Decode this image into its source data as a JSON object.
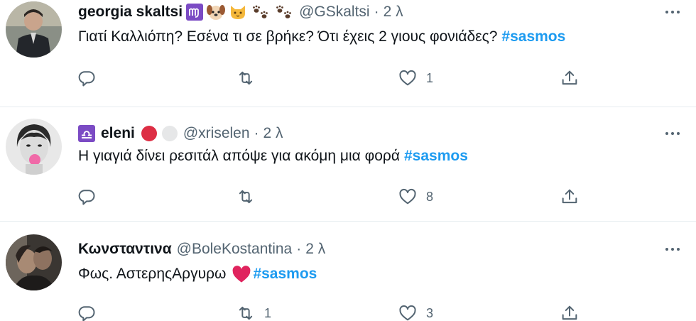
{
  "tweets": [
    {
      "name": "georgia skaltsi",
      "handle": "@GSkaltsi",
      "dot": "·",
      "time": "2 λ",
      "text": "Γιατί Καλλιόπη? Εσένα τι σε βρήκε? Ότι έχεις 2 γιους φονιάδες?",
      "hashtag": "#sasmos",
      "reply_count": "",
      "retweet_count": "",
      "like_count": "1"
    },
    {
      "name": "eleni",
      "handle": "@xriselen",
      "dot": "·",
      "time": "2 λ",
      "text": "Η γιαγιά δίνει ρεσιτάλ απόψε για ακόμη μια φορά",
      "hashtag": "#sasmos",
      "reply_count": "",
      "retweet_count": "",
      "like_count": "8"
    },
    {
      "name": "Κωνσταντινα",
      "handle": "@BoleKostantina",
      "dot": "·",
      "time": "2 λ",
      "text": "Φως. ΑστερηςΑργυρω",
      "hashtag": "#sasmos",
      "reply_count": "",
      "retweet_count": "1",
      "like_count": "3"
    }
  ],
  "colors": {
    "link": "#1d9bf0",
    "secondary_text": "#536471",
    "primary_text": "#0f1419",
    "divider": "#e6ecf0",
    "badge_purple": "#7b4bc4",
    "heart_red": "#e0245e"
  },
  "icons": [
    "virgo-sign-icon",
    "dog-face-emoji",
    "cat-face-emoji",
    "paw-prints-emoji",
    "libra-sign-icon",
    "red-circle-emoji",
    "white-circle-emoji",
    "red-heart-emoji",
    "reply-icon",
    "retweet-icon",
    "like-icon",
    "share-icon",
    "more-options-icon"
  ]
}
